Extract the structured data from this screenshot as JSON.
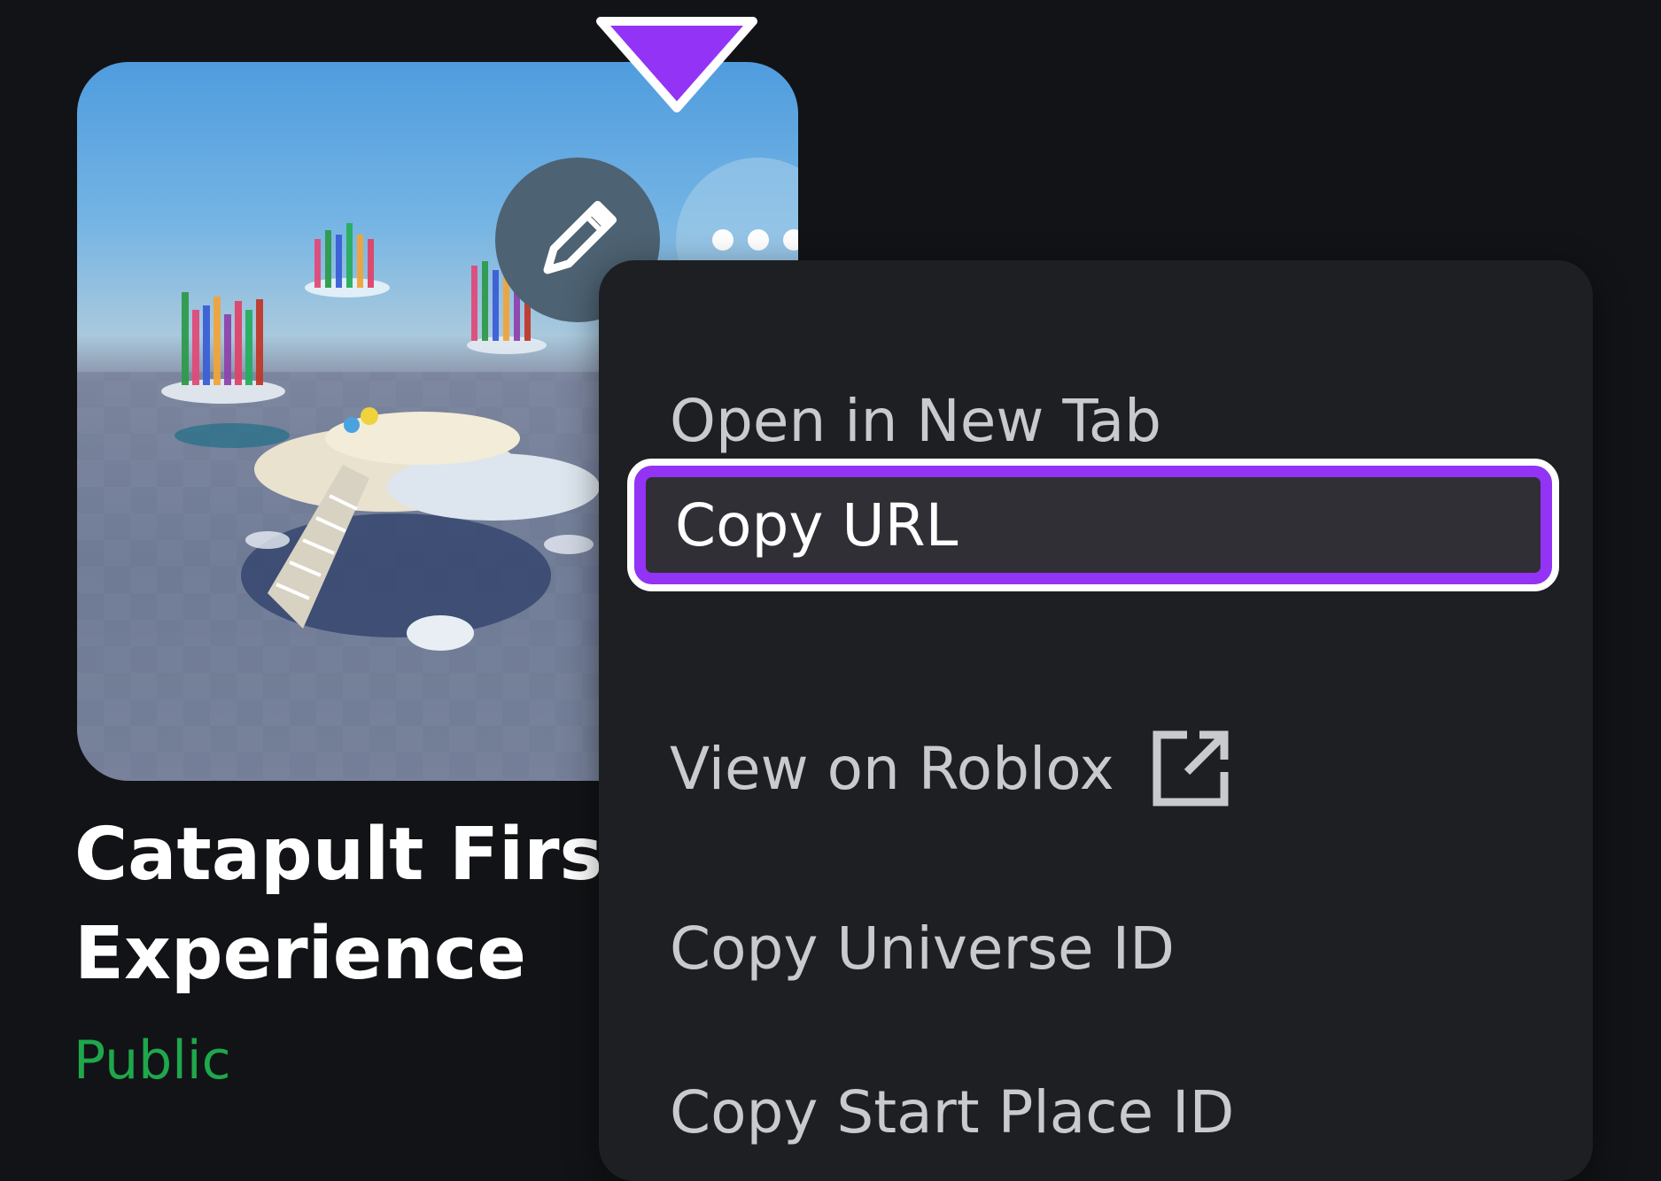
{
  "experience": {
    "title_line1": "Catapult First",
    "title_line2": "Experience",
    "status": "Public"
  },
  "thumbnail": {
    "edit_icon": "pencil-icon",
    "more_icon": "more-horizontal-icon"
  },
  "context_menu": {
    "items": [
      {
        "label": "Open in New Tab"
      },
      {
        "label": "Copy URL",
        "selected": true
      },
      {
        "label": "View on Roblox",
        "icon": "external-link-icon"
      },
      {
        "label": "Copy Universe ID"
      },
      {
        "label": "Copy Start Place ID"
      }
    ]
  },
  "colors": {
    "background": "#121316",
    "menu_background": "#1e1f23",
    "highlight": "#9333f5",
    "status_public": "#1fa74c"
  }
}
